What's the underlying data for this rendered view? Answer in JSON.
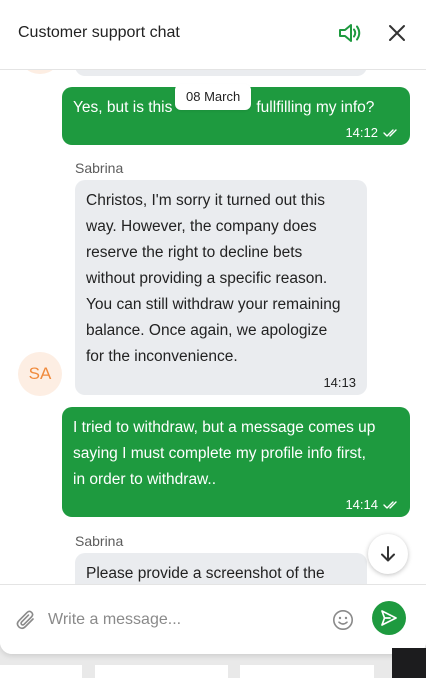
{
  "header": {
    "title": "Customer support chat",
    "sound_icon": "speaker-icon",
    "close_icon": "close-icon"
  },
  "date_separator": "08 March",
  "messages": [
    {
      "direction": "out",
      "lines": [
        "Yes, but is this",
        "fullfilling my info?"
      ],
      "time": "14:12"
    },
    {
      "direction": "in",
      "sender": "Sabrina",
      "lines": [
        "Christos, I'm sorry it turned out this",
        "way. However, the company does",
        "reserve the right to decline bets",
        "without providing a specific reason.",
        "You can still withdraw your remaining",
        "balance. Once again, we apologize",
        "for the inconvenience."
      ],
      "time": "14:13",
      "avatar": "SA"
    },
    {
      "direction": "out",
      "lines": [
        "I tried to withdraw, but a message comes up",
        "saying I must complete my profile info first,",
        "in order to withdraw.."
      ],
      "time": "14:14"
    },
    {
      "direction": "in",
      "sender": "Sabrina",
      "lines": [
        "Please provide a screenshot of the"
      ]
    }
  ],
  "composer": {
    "placeholder": "Write a message...",
    "attach_icon": "paperclip-icon",
    "emoji_icon": "emoji-icon",
    "send_icon": "send-icon"
  },
  "colors": {
    "accent": "#1e9a3f",
    "incoming_bubble": "#eaecef",
    "avatar_bg": "#fdeee3",
    "avatar_text": "#f08a3c"
  }
}
